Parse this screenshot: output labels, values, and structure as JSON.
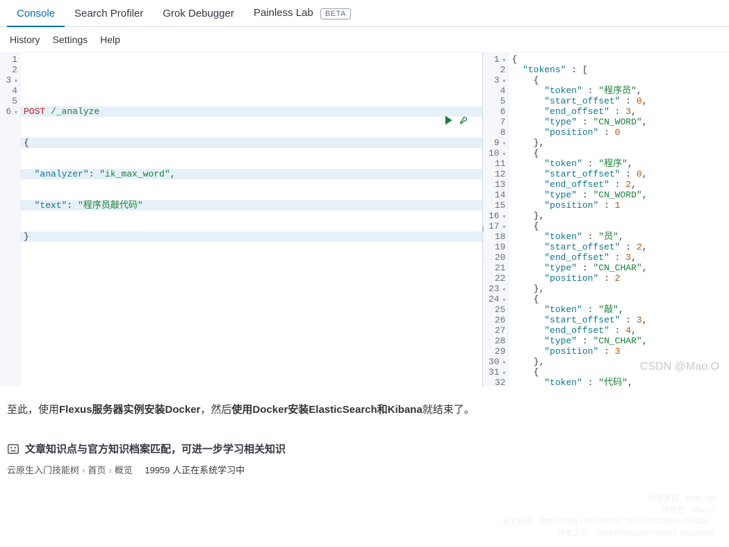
{
  "tabs": {
    "console": "Console",
    "search_profiler": "Search Profiler",
    "grok_debugger": "Grok Debugger",
    "painless_lab": "Painless Lab",
    "beta_badge": "BETA"
  },
  "subnav": {
    "history": "History",
    "settings": "Settings",
    "help": "Help"
  },
  "request": {
    "method": "POST",
    "path": "/_analyze",
    "body": {
      "analyzer_key": "\"analyzer\"",
      "analyzer_val": "\"ik_max_word\"",
      "text_key": "\"text\"",
      "text_val": "\"程序员敲代码\""
    },
    "line_numbers": [
      "1",
      "2",
      "3",
      "4",
      "5",
      "6"
    ]
  },
  "response": {
    "line_numbers": [
      "1",
      "2",
      "3",
      "4",
      "5",
      "6",
      "7",
      "8",
      "9",
      "10",
      "11",
      "12",
      "13",
      "14",
      "15",
      "16",
      "17",
      "18",
      "19",
      "20",
      "21",
      "22",
      "23",
      "24",
      "25",
      "26",
      "27",
      "28",
      "29",
      "30",
      "31",
      "32"
    ],
    "fold_lines": [
      1,
      3,
      9,
      10,
      16,
      17,
      23,
      24,
      30,
      31
    ],
    "tokens_key": "\"tokens\"",
    "tok": [
      {
        "token": "\"程序员\"",
        "start": "0",
        "end": "3",
        "type": "\"CN_WORD\"",
        "pos": "0"
      },
      {
        "token": "\"程序\"",
        "start": "0",
        "end": "2",
        "type": "\"CN_WORD\"",
        "pos": "1"
      },
      {
        "token": "\"员\"",
        "start": "2",
        "end": "3",
        "type": "\"CN_CHAR\"",
        "pos": "2"
      },
      {
        "token": "\"敲\"",
        "start": "3",
        "end": "4",
        "type": "\"CN_CHAR\"",
        "pos": "3"
      }
    ],
    "last_token": "\"代码\"",
    "keys": {
      "token": "\"token\"",
      "start_offset": "\"start_offset\"",
      "end_offset": "\"end_offset\"",
      "type": "\"type\"",
      "position": "\"position\""
    }
  },
  "article_parts": {
    "p1": "至此，使用",
    "b1": "Flexus服务器实例安装Docker",
    "p2": "，然后",
    "b2": "使用Docker安装ElasticSearch和Kibana",
    "p3": "就结束了。"
  },
  "knowledge_title": "文章知识点与官方知识档案匹配，可进一步学习相关知识",
  "breadcrumb": {
    "a": "云原生入门技能树",
    "b": "首页",
    "c": "概览",
    "count": "19959 人正在系统学习中"
  },
  "watermark": "CSDN @Mao.O",
  "foot": {
    "l1": "内容来自　csdn.net",
    "l2": "作者名　Mao.O",
    "l3": "原文链接　https://blog.csdn.net/m0_60155332/article/details/...",
    "l4": "作者主页　https://blog.csdn.net/m0_60155332"
  }
}
